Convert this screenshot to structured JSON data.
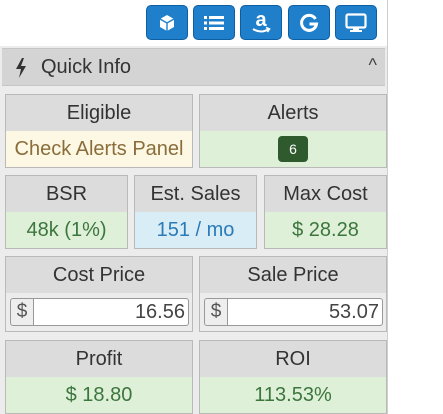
{
  "toolbar": {
    "buttons": [
      {
        "icon": "box-icon"
      },
      {
        "icon": "list-icon"
      },
      {
        "icon": "amazon-icon",
        "glyph": "a"
      },
      {
        "icon": "google-icon",
        "glyph": "G"
      },
      {
        "icon": "monitor-icon"
      }
    ],
    "button_color": "#1f7fcb"
  },
  "quick_info": {
    "title": "Quick Info",
    "collapse_glyph": "^"
  },
  "cards": {
    "eligible": {
      "label": "Eligible",
      "value": "Check Alerts Panel"
    },
    "alerts": {
      "label": "Alerts",
      "count": "6"
    },
    "bsr": {
      "label": "BSR",
      "value": "48k (1%)"
    },
    "est_sales": {
      "label": "Est. Sales",
      "value": "151 / mo"
    },
    "max_cost": {
      "label": "Max Cost",
      "value": "$ 28.28"
    },
    "cost_price": {
      "label": "Cost Price",
      "currency": "$",
      "value": "16.56"
    },
    "sale_price": {
      "label": "Sale Price",
      "currency": "$",
      "value": "53.07"
    },
    "profit": {
      "label": "Profit",
      "value": "$ 18.80"
    },
    "roi": {
      "label": "ROI",
      "value": "113.53%"
    }
  },
  "colors": {
    "success_bg": "#dff0d8",
    "success_text": "#3c763d",
    "warning_bg": "#fcf8e3",
    "warning_text": "#8a6d3b",
    "info_bg": "#d9edf7",
    "info_text": "#2b7bb9",
    "badge_bg": "#2e5a2e"
  }
}
